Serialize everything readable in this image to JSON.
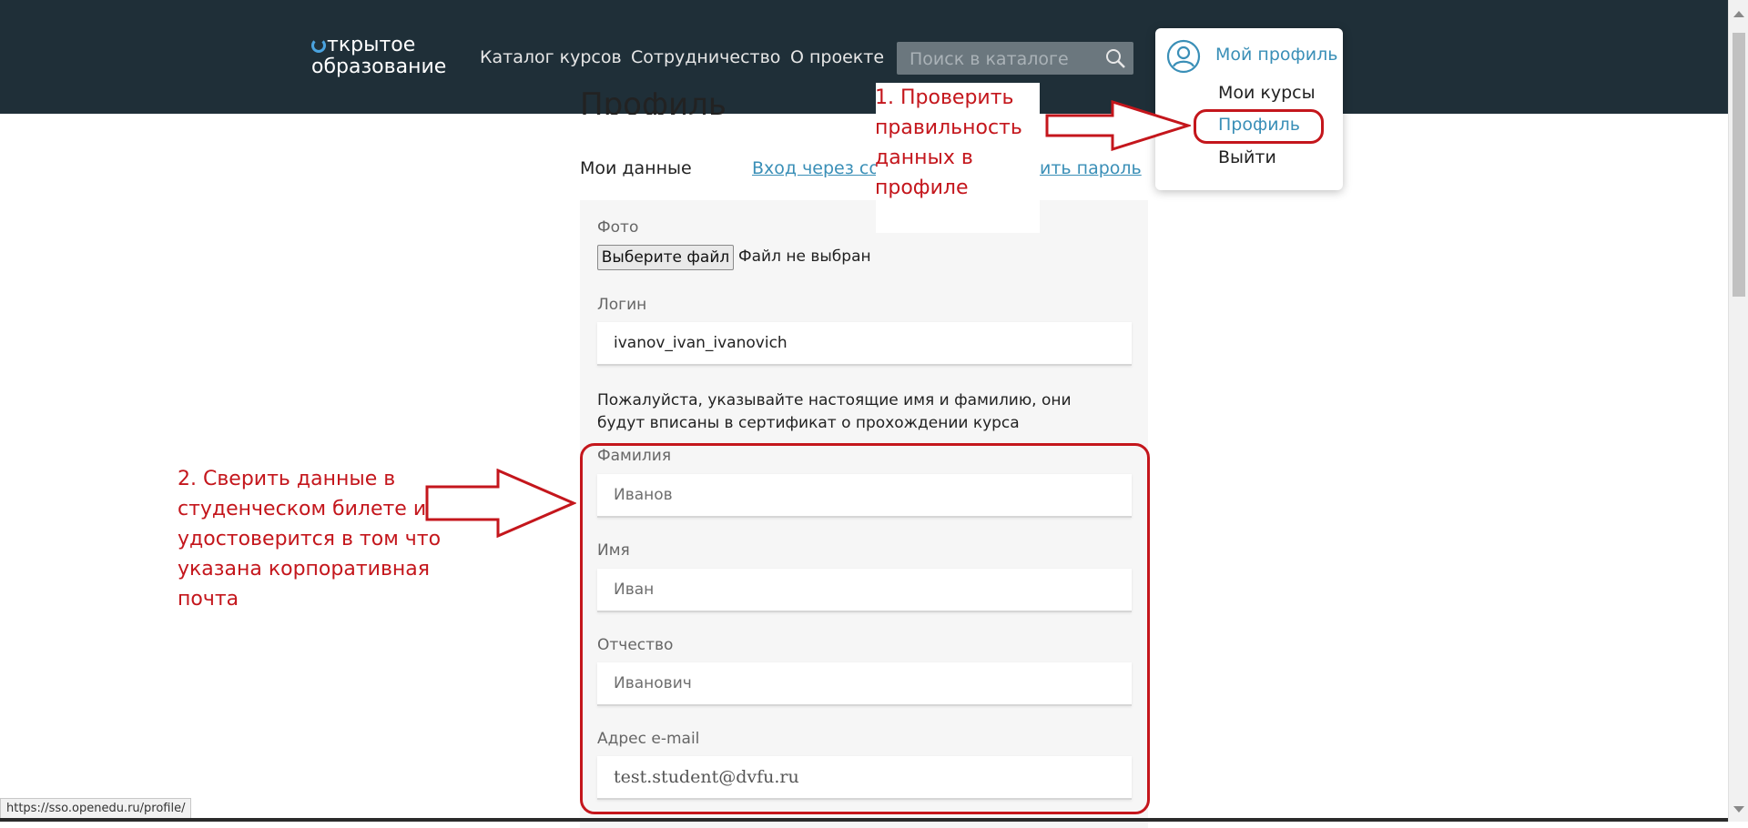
{
  "header": {
    "logo_line1": "ткрытое",
    "logo_line2": "образование",
    "nav": [
      "Каталог курсов",
      "Сотрудничество",
      "О проекте"
    ],
    "search_placeholder": "Поиск в каталоге"
  },
  "dropdown": {
    "title": "Мой профиль",
    "items": [
      "Мои курсы",
      "Профиль",
      "Выйти"
    ]
  },
  "main": {
    "page_title": "Профиль",
    "tabs": [
      "Мои данные",
      "Вход через со",
      "ить пароль"
    ],
    "photo_label": "Фото",
    "file_button": "Выберите файл",
    "file_status": "Файл не выбран",
    "login_label": "Логин",
    "login_value": "ivanov_ivan_ivanovich",
    "notice": "Пожалуйста, указывайте настоящие имя и фамилию, они будут вписаны в сертификат о прохождении курса",
    "surname_label": "Фамилия",
    "surname_value": "Иванов",
    "name_label": "Имя",
    "name_value": "Иван",
    "patronymic_label": "Отчество",
    "patronymic_value": "Иванович",
    "email_label": "Адрес e-mail",
    "email_value": "test.student@dvfu.ru"
  },
  "annotations": {
    "step1": "1. Проверить правильность данных в профиле",
    "step2": "2. Сверить данные в студенческом билете и удостоверится в том что указана корпоративная почта"
  },
  "statusbar": {
    "url": "https://sso.openedu.ru/profile/"
  },
  "colors": {
    "header_bg": "#1f2f38",
    "accent": "#3a8fb7",
    "annotation_red": "#c4161c"
  }
}
